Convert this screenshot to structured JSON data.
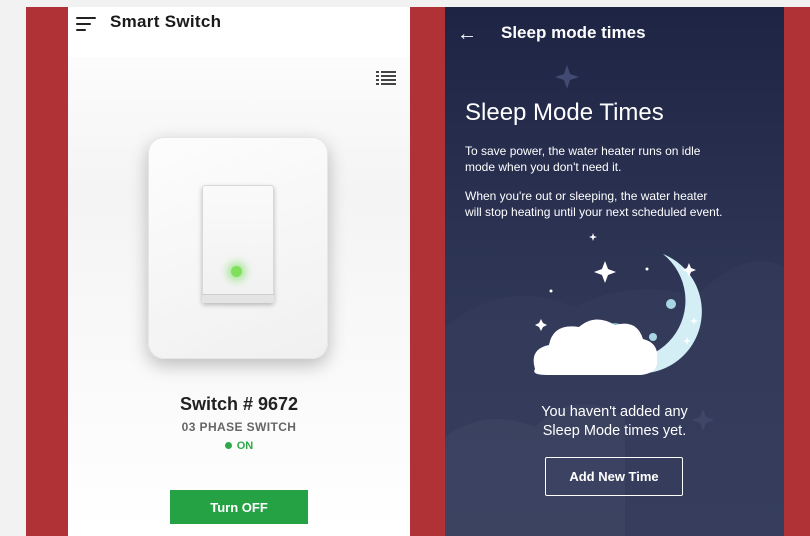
{
  "left_screen": {
    "app_title": "Smart Switch",
    "switch_name": "Switch # 9672",
    "switch_type": "03 PHASE SWITCH",
    "status": "ON",
    "turn_off_label": "Turn OFF",
    "colors": {
      "accent_green": "#25a244",
      "led_green": "#7ee05b"
    }
  },
  "right_screen": {
    "title": "Sleep mode times",
    "heading": "Sleep Mode Times",
    "paragraph_1": "To save power, the water heater runs on idle\nmode when you don't need it.",
    "paragraph_2": "When you're out or sleeping, the water heater\nwill stop heating until your next scheduled event.",
    "empty_message": "You haven't added any\nSleep Mode times yet.",
    "add_button_label": "Add New Time",
    "colors": {
      "background_top": "#1e2444",
      "background_bottom": "#3b4260"
    }
  },
  "icons": [
    "menu-icon",
    "list-view-icon",
    "back-arrow-icon",
    "moon-illustration"
  ],
  "frame_color": "#b03236"
}
